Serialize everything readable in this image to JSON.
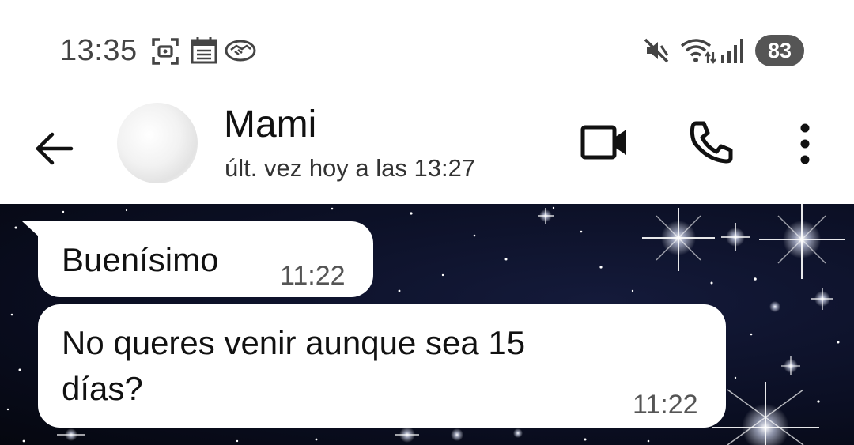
{
  "status_bar": {
    "time": "13:35",
    "battery": "83",
    "icons": [
      "screenshot-icon",
      "calendar-icon",
      "handshake-icon",
      "mute-icon",
      "wifi-icon",
      "signal-icon",
      "battery-icon"
    ]
  },
  "header": {
    "contact_name": "Mami",
    "last_seen": "últ. vez hoy a las 13:27",
    "icons": [
      "back-arrow-icon",
      "video-call-icon",
      "phone-icon",
      "more-options-icon"
    ]
  },
  "messages": [
    {
      "text": "Buenísimo",
      "time": "11:22"
    },
    {
      "text_line1": "No queres venir aunque sea 15",
      "text_line2": "días?",
      "time": "11:22"
    }
  ],
  "colors": {
    "header_bg": "#ffffff",
    "chat_bg": "#0b0f24",
    "bubble_bg": "#ffffff",
    "time_text": "#555555"
  }
}
